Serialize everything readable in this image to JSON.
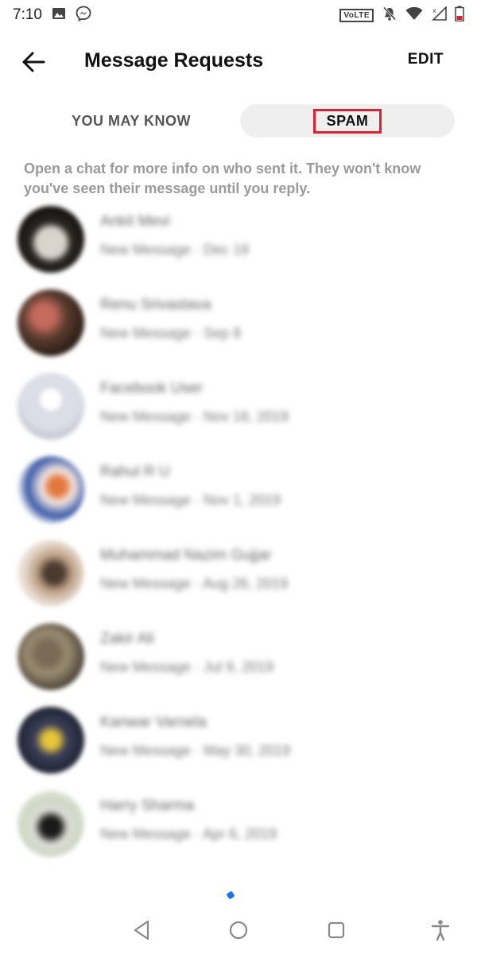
{
  "status_bar": {
    "time": "7:10",
    "volte": "VoLTE",
    "icons_left": [
      "image-icon",
      "messenger-icon"
    ],
    "icons_right": [
      "volte-icon",
      "mute-icon",
      "wifi-icon",
      "signal-icon",
      "battery-icon"
    ]
  },
  "header": {
    "title": "Message Requests",
    "edit_label": "EDIT"
  },
  "tabs": {
    "you_may_know": "YOU MAY KNOW",
    "spam": "SPAM",
    "selected": "spam",
    "highlight_color": "#d92231"
  },
  "info_text": "Open a chat for more info on who sent it. They won't know you've seen their message until you reply.",
  "requests": [
    {
      "name": "Ankit Mevi",
      "subtitle": "New Message · Dec 18"
    },
    {
      "name": "Renu Srivastava",
      "subtitle": "New Message · Sep 8"
    },
    {
      "name": "Facebook User",
      "subtitle": "New Message · Nov 16, 2019"
    },
    {
      "name": "Rahul R U",
      "subtitle": "New Message · Nov 1, 2019"
    },
    {
      "name": "Muhammad Nazim Gujjar",
      "subtitle": "New Message · Aug 26, 2019"
    },
    {
      "name": "Zakir Ali",
      "subtitle": "New Message · Jul 9, 2019"
    },
    {
      "name": "Kanwar Varnela",
      "subtitle": "New Message · May 30, 2019"
    },
    {
      "name": "Harry Sharma",
      "subtitle": "New Message · Apr 6, 2019"
    }
  ],
  "colors": {
    "accent_red": "#d92231",
    "muted_text": "#9a9a9a",
    "segment_bg": "#efefef"
  }
}
